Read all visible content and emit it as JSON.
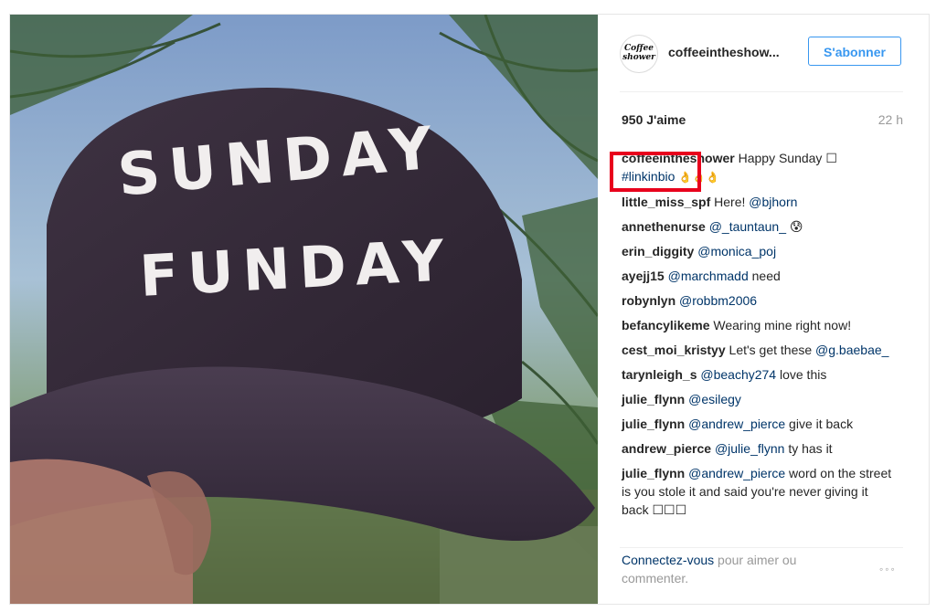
{
  "post": {
    "cap_text_line1": "SUNDAY",
    "cap_text_line2": "FUNDAY"
  },
  "header": {
    "avatar_text": "Coffee shower",
    "username": "coffeeintheshow...",
    "follow_label": "S'abonner"
  },
  "stats": {
    "likes": "950 J'aime",
    "time": "22 h"
  },
  "caption": {
    "author": "coffeeintheshower",
    "text": "Happy Sunday ☐",
    "hashtag": "#linkinbio",
    "emojis": "👌👌👌"
  },
  "comments": [
    {
      "author": "little_miss_spf",
      "pre": "Here! ",
      "mention": "@bjhorn",
      "post": ""
    },
    {
      "author": "annethenurse",
      "pre": "",
      "mention": "@_tauntaun_",
      "post": " 😰"
    },
    {
      "author": "erin_diggity",
      "pre": "",
      "mention": "@monica_poj",
      "post": ""
    },
    {
      "author": "ayejj15",
      "pre": "",
      "mention": "@marchmadd",
      "post": " need"
    },
    {
      "author": "robynlyn",
      "pre": "",
      "mention": "@robbm2006",
      "post": ""
    },
    {
      "author": "befancylikeme",
      "pre": "Wearing mine right now!",
      "mention": "",
      "post": ""
    },
    {
      "author": "cest_moi_kristyy",
      "pre": "Let's get these ",
      "mention": "@g.baebae_",
      "post": ""
    },
    {
      "author": "tarynleigh_s",
      "pre": "",
      "mention": "@beachy274",
      "post": " love this"
    },
    {
      "author": "julie_flynn",
      "pre": "",
      "mention": "@esilegy",
      "post": ""
    },
    {
      "author": "julie_flynn",
      "pre": "",
      "mention": "@andrew_pierce",
      "post": " give it back"
    },
    {
      "author": "andrew_pierce",
      "pre": "",
      "mention": "@julie_flynn",
      "post": " ty has it"
    },
    {
      "author": "julie_flynn",
      "pre": "",
      "mention": "@andrew_pierce",
      "post": " word on the street is you stole it and said you're never giving it back ☐☐☐"
    }
  ],
  "footer": {
    "login_link": "Connectez-vous",
    "login_text": " pour aimer ou commenter.",
    "more": "◦◦◦"
  }
}
